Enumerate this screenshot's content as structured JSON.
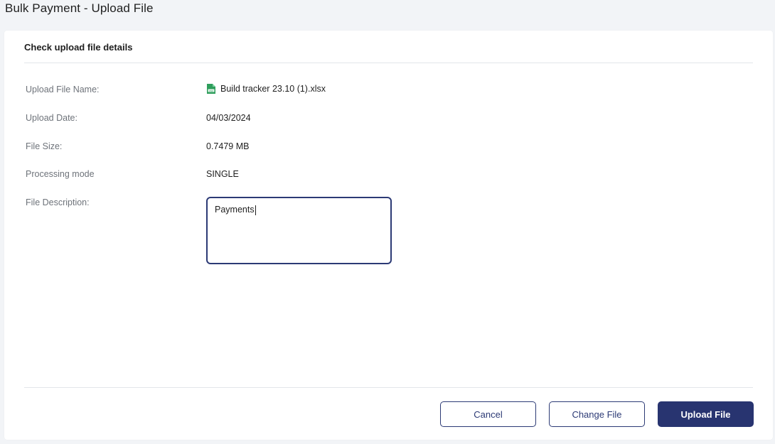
{
  "page": {
    "title": "Bulk Payment - Upload File"
  },
  "card": {
    "section_title": "Check upload file details",
    "fields": {
      "file_name": {
        "label": "Upload File Name:",
        "value": "Build tracker 23.10 (1).xlsx",
        "icon": "spreadsheet-file-icon",
        "icon_color": "#2e9e5b"
      },
      "upload_date": {
        "label": "Upload Date:",
        "value": "04/03/2024"
      },
      "file_size": {
        "label": "File Size:",
        "value": "0.7479 MB"
      },
      "processing_mode": {
        "label": "Processing mode",
        "value": "SINGLE"
      },
      "file_description": {
        "label": "File Description:",
        "value": "Payments"
      }
    }
  },
  "actions": {
    "cancel_label": "Cancel",
    "change_file_label": "Change File",
    "upload_file_label": "Upload File"
  },
  "colors": {
    "primary": "#283470",
    "outline": "#2c3a75",
    "background": "#f2f4f7"
  }
}
